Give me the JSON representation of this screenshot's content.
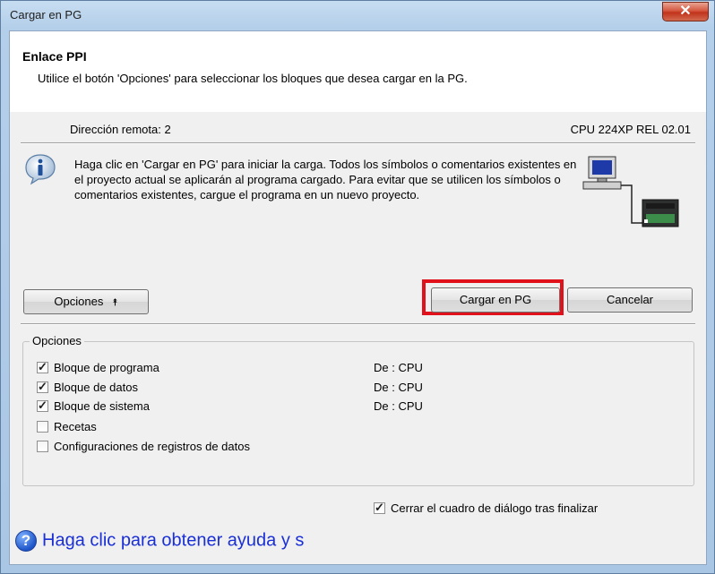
{
  "window": {
    "title": "Cargar en PG",
    "close_glyph": "✕"
  },
  "header": {
    "title": "Enlace PPI",
    "subtitle": "Utilice el botón 'Opciones' para seleccionar los bloques que desea cargar en la PG."
  },
  "status": {
    "remote_address": "Dirección remota: 2",
    "cpu": "CPU 224XP REL 02.01"
  },
  "info": {
    "icon": "info-icon",
    "text": "Haga clic en 'Cargar en PG' para iniciar la carga. Todos los símbolos o comentarios existentes en el proyecto actual se aplicarán al programa cargado. Para evitar que se utilicen los símbolos o comentarios existentes, cargue el programa en un nuevo proyecto.",
    "diagram_icon": "pc-plc-network-icon"
  },
  "buttons": {
    "opciones": "Opciones",
    "opciones_arrow": "⯭",
    "cargar": "Cargar en PG",
    "cancelar": "Cancelar"
  },
  "options_group": {
    "label": "Opciones",
    "items": [
      {
        "label": "Bloque de programa",
        "checked": true,
        "source": "De : CPU"
      },
      {
        "label": "Bloque de datos",
        "checked": true,
        "source": "De : CPU"
      },
      {
        "label": "Bloque de sistema",
        "checked": true,
        "source": "De : CPU"
      },
      {
        "label": "Recetas",
        "checked": false,
        "source": ""
      },
      {
        "label": "Configuraciones de registros de datos",
        "checked": false,
        "source": ""
      }
    ]
  },
  "footer": {
    "close_after": "Cerrar el cuadro de diálogo tras finalizar",
    "close_after_checked": true,
    "help_text": "Haga clic para obtener ayuda y s",
    "help_icon_glyph": "?"
  },
  "colors": {
    "highlight": "#e0111a",
    "help_link": "#1a2fd6"
  }
}
